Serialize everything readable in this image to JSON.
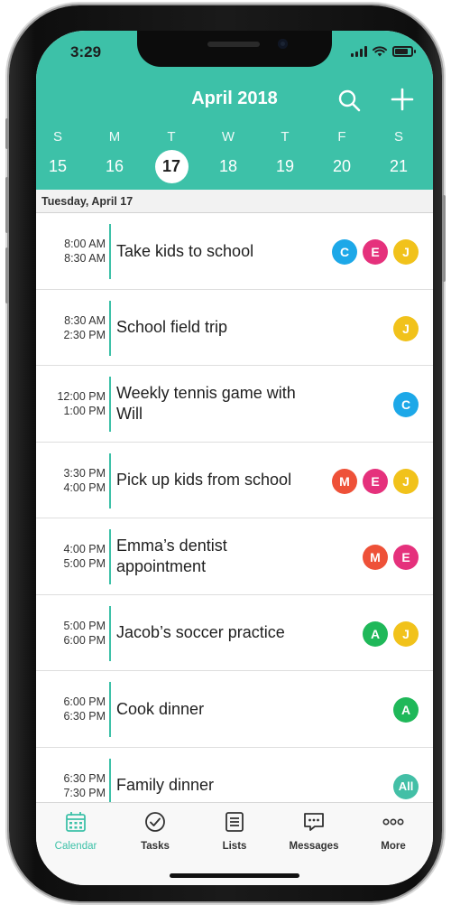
{
  "status_bar": {
    "time": "3:29",
    "battery_level": 0.85
  },
  "header": {
    "month_title": "April 2018",
    "search_icon": "search-icon",
    "add_icon": "plus-icon",
    "week": [
      {
        "letter": "S",
        "day": "15",
        "selected": false
      },
      {
        "letter": "M",
        "day": "16",
        "selected": false
      },
      {
        "letter": "T",
        "day": "17",
        "selected": true
      },
      {
        "letter": "W",
        "day": "18",
        "selected": false
      },
      {
        "letter": "T",
        "day": "19",
        "selected": false
      },
      {
        "letter": "F",
        "day": "20",
        "selected": false
      },
      {
        "letter": "S",
        "day": "21",
        "selected": false
      }
    ]
  },
  "date_label": "Tuesday, April 17",
  "colors": {
    "accent": "#3dc1a8",
    "C": "#1da8e8",
    "E": "#e5317c",
    "J": "#f1c21b",
    "M": "#ee5138",
    "A": "#1fb859",
    "All": "#43bfa6"
  },
  "events": [
    {
      "start": "8:00 AM",
      "end": "8:30 AM",
      "title": "Take kids to school",
      "people": [
        "C",
        "E",
        "J"
      ]
    },
    {
      "start": "8:30 AM",
      "end": "2:30 PM",
      "title": "School field trip",
      "people": [
        "J"
      ]
    },
    {
      "start": "12:00 PM",
      "end": "1:00 PM",
      "title": "Weekly tennis game with Will",
      "people": [
        "C"
      ]
    },
    {
      "start": "3:30 PM",
      "end": "4:00 PM",
      "title": "Pick up kids from school",
      "people": [
        "M",
        "E",
        "J"
      ]
    },
    {
      "start": "4:00 PM",
      "end": "5:00 PM",
      "title": "Emma’s dentist appointment",
      "people": [
        "M",
        "E"
      ]
    },
    {
      "start": "5:00 PM",
      "end": "6:00 PM",
      "title": "Jacob’s soccer practice",
      "people": [
        "A",
        "J"
      ]
    },
    {
      "start": "6:00 PM",
      "end": "6:30 PM",
      "title": "Cook dinner",
      "people": [
        "A"
      ]
    },
    {
      "start": "6:30 PM",
      "end": "7:30 PM",
      "title": "Family dinner",
      "people": [
        "All"
      ]
    }
  ],
  "tabs": [
    {
      "key": "calendar",
      "label": "Calendar",
      "icon": "calendar-icon",
      "active": true
    },
    {
      "key": "tasks",
      "label": "Tasks",
      "icon": "check-circle-icon",
      "active": false
    },
    {
      "key": "lists",
      "label": "Lists",
      "icon": "list-icon",
      "active": false
    },
    {
      "key": "messages",
      "label": "Messages",
      "icon": "chat-bubble-icon",
      "active": false
    },
    {
      "key": "more",
      "label": "More",
      "icon": "more-dots-icon",
      "active": false
    }
  ]
}
